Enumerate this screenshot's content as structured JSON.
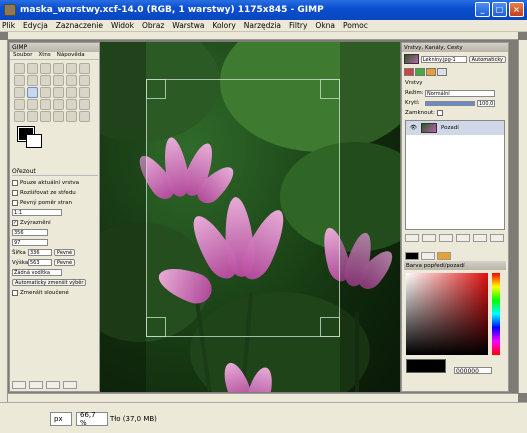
{
  "window": {
    "title": "maska_warstwy.xcf-14.0 (RGB, 1 warstwy) 1175x845 - GIMP"
  },
  "menu": [
    "Plik",
    "Edycja",
    "Zaznaczenie",
    "Widok",
    "Obraz",
    "Warstwa",
    "Kolory",
    "Narzędzia",
    "Filtry",
    "Okna",
    "Pomoc"
  ],
  "toolbox": {
    "title": "GIMP",
    "menu": [
      "Soubor",
      "Xtns",
      "Nápověda"
    ],
    "options_title": "Ořezout",
    "options": {
      "opt1": "Pouze aktuální vrstva",
      "opt2": "Rozšiřovat ze středu",
      "opt3": "Pevný poměr stran",
      "ratio": "1:1",
      "highlight": "Zvýraznění",
      "v1": "356",
      "v2": "97",
      "sirka_label": "Šířka",
      "sirka": "336",
      "vyska_label": "Výška",
      "vyska": "563",
      "btn_pevne": "Pevné",
      "guides": "Žádná vodítka",
      "auto": "Automaticky zmenšit výběr",
      "merged": "Zmenšit sloučené"
    }
  },
  "layers": {
    "title": "Vrstvy, Kanály, Cesty",
    "image": "Lekníny.jpg-1",
    "auto": "Automaticky",
    "tab": "Vrstvy",
    "mode_label": "Režim:",
    "mode": "Normální",
    "opacity_label": "Krytí:",
    "opacity": "100,0",
    "lock_label": "Zamknout:",
    "layer_name": "Pozadí"
  },
  "colors": {
    "title": "Barva popředí/pozadí",
    "hex": "000000"
  },
  "status": {
    "unit": "px",
    "zoom": "66,7 %",
    "info": "Tło (37,0 MB)"
  }
}
